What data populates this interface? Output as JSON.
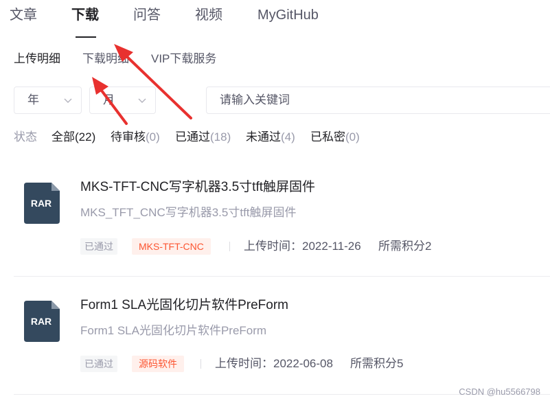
{
  "tabs": [
    {
      "label": "文章",
      "active": false
    },
    {
      "label": "下载",
      "active": true
    },
    {
      "label": "问答",
      "active": false
    },
    {
      "label": "视频",
      "active": false
    },
    {
      "label": "MyGitHub",
      "active": false
    }
  ],
  "subtabs": [
    {
      "label": "上传明细",
      "active": true
    },
    {
      "label": "下载明细",
      "active": false
    },
    {
      "label": "VIP下载服务",
      "active": false
    }
  ],
  "filters": {
    "year_label": "年",
    "month_label": "月",
    "search_placeholder": "请输入关键词"
  },
  "status": {
    "label": "状态",
    "items": [
      {
        "name": "全部",
        "count": "(22)",
        "active": true
      },
      {
        "name": "待审核",
        "count": "(0)",
        "active": false
      },
      {
        "name": "已通过",
        "count": "(18)",
        "active": false
      },
      {
        "name": "未通过",
        "count": "(4)",
        "active": false
      },
      {
        "name": "已私密",
        "count": "(0)",
        "active": false
      }
    ]
  },
  "resources": [
    {
      "icon_ext": "RAR",
      "title": "MKS-TFT-CNC写字机器3.5寸tft触屏固件",
      "desc": "MKS_TFT_CNC写字机器3.5寸tft触屏固件",
      "status": "已通过",
      "tag": "MKS-TFT-CNC",
      "upload_time": "上传时间：2022-11-26",
      "points": "所需积分2"
    },
    {
      "icon_ext": "RAR",
      "title": "Form1 SLA光固化切片软件PreForm",
      "desc": "Form1 SLA光固化切片软件PreForm",
      "status": "已通过",
      "tag": "源码软件",
      "upload_time": "上传时间：2022-06-08",
      "points": "所需积分5"
    }
  ],
  "watermark": "CSDN @hu5566798",
  "colors": {
    "accent": "#fc5531",
    "tag_bg": "#fff0ec",
    "icon_bg": "#34495e",
    "arrow": "#e8312f",
    "text_primary": "#222226",
    "text_secondary": "#999aaa"
  }
}
